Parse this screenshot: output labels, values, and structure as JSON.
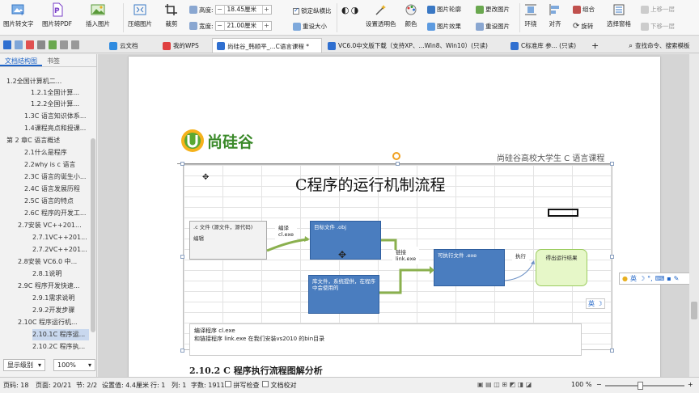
{
  "ribbon": {
    "img_to_text": "图片转文字",
    "img_to_pdf": "图片转PDF",
    "insert_image": "插入图片",
    "compress_image": "压缩图片",
    "crop": "裁剪",
    "height_label": "高度:",
    "height_value": "18.45厘米",
    "width_label": "宽度:",
    "width_value": "21.00厘米",
    "lock_ratio": "锁定纵横比",
    "reset_size": "重设大小",
    "set_transparent": "设置透明色",
    "color": "颜色",
    "image_outline": "图片轮廓",
    "image_effect": "图片效果",
    "change_image": "更改图片",
    "reset_image": "重设图片",
    "wrap": "环绕",
    "align": "对齐",
    "group": "组合",
    "rotate": "旋转",
    "selection_pane": "选择窗格",
    "bring_forward": "上移一层",
    "send_backward": "下移一层"
  },
  "tabs": [
    {
      "label": "云文档"
    },
    {
      "label": "我的WPS"
    },
    {
      "label": "尚硅谷_韩顺平_...C语言课程 *"
    },
    {
      "label": "VC6.0中文版下载（支持XP、...Win8、Win10）(只读)"
    },
    {
      "label": "C标准库 参... (只读)"
    }
  ],
  "tab_search": "查找命令、搜索模板",
  "sidebar": {
    "tab_outline": "文档结构图",
    "tab_bookmark": "书签",
    "items": [
      {
        "label": "1.2全国计算机二..."
      },
      {
        "label": "1.2.1全国计算..."
      },
      {
        "label": "1.2.2全国计算..."
      },
      {
        "label": "1.3C 语言知识体系..."
      },
      {
        "label": "1.4课程亮点和授课..."
      },
      {
        "label": "第 2 章C 语言概述"
      },
      {
        "label": "2.1什么是程序"
      },
      {
        "label": "2.2why is c 语言"
      },
      {
        "label": "2.3C 语言的诞生小..."
      },
      {
        "label": "2.4C 语言发展历程"
      },
      {
        "label": "2.5C 语言的特点"
      },
      {
        "label": "2.6C 程序的开发工..."
      },
      {
        "label": "2.7安装 VC++201..."
      },
      {
        "label": "2.7.1VC++201..."
      },
      {
        "label": "2.7.2VC++201..."
      },
      {
        "label": "2.8安装 VC6.0 中..."
      },
      {
        "label": "2.8.1说明"
      },
      {
        "label": "2.9C 程序开发快速..."
      },
      {
        "label": "2.9.1需求说明"
      },
      {
        "label": "2.9.2开发步骤"
      },
      {
        "label": "2.10C 程序运行机..."
      },
      {
        "label": "2.10.1C 程序运..."
      },
      {
        "label": "2.10.2C 程序执..."
      }
    ],
    "display_level": "显示级别",
    "zoom": "100%"
  },
  "page": {
    "logo_text": "尚硅谷",
    "header_text": "尚硅谷高校大学生 C 语言课程",
    "diagram_title": "C程序的运行机制流程",
    "source_label_1": ".c 文件 (源文件，源代码)",
    "source_label_2": "编辑",
    "compile_label_1": "编译",
    "compile_label_2": "cl.exe",
    "obj_label": "目标文件 .obj",
    "lib_label": "库文件，系统提供，在程序中会使用的",
    "link_label_1": "链接",
    "link_label_2": "link.exe",
    "exe_label": "可执行文件 .exe",
    "run_label": "执行",
    "result_label": "得出运行结果",
    "note_line_1": "编译程序  cl.exe",
    "note_line_2": "和链接程序 link.exe 在我们安装vs2010 的bin目录",
    "section_heading": "2.10.2   C 程序执行流程图解分析",
    "ime_label": "英"
  },
  "status": {
    "page": "页码: 18",
    "pages": "页面: 20/21",
    "section": "节: 2/2",
    "setting": "设置值: 4.4厘米",
    "row": "行: 1",
    "col": "列: 1",
    "words": "字数: 1911",
    "spell": "拼写检查",
    "proof": "文档校对",
    "zoom": "100 %"
  }
}
